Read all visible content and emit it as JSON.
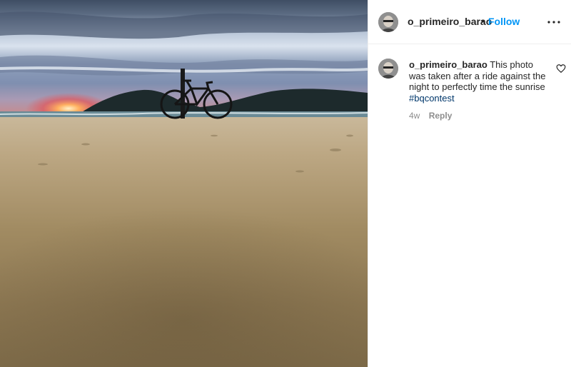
{
  "post": {
    "username": "o_primeiro_barao",
    "follow_label": "Follow",
    "separator": "•",
    "more_icon": "more-options-icon",
    "photo_icon": "beach-bicycle-sunrise-photo"
  },
  "caption": {
    "username": "o_primeiro_barao",
    "text": "This photo was taken after a ride against the night to perfectly time the sunrise",
    "hashtag": "#bqcontest",
    "age": "4w",
    "reply_label": "Reply",
    "like_icon": "heart-icon"
  },
  "colors": {
    "follow": "#0095f6",
    "hashtag": "#00376b",
    "meta": "#8e8e8e"
  }
}
